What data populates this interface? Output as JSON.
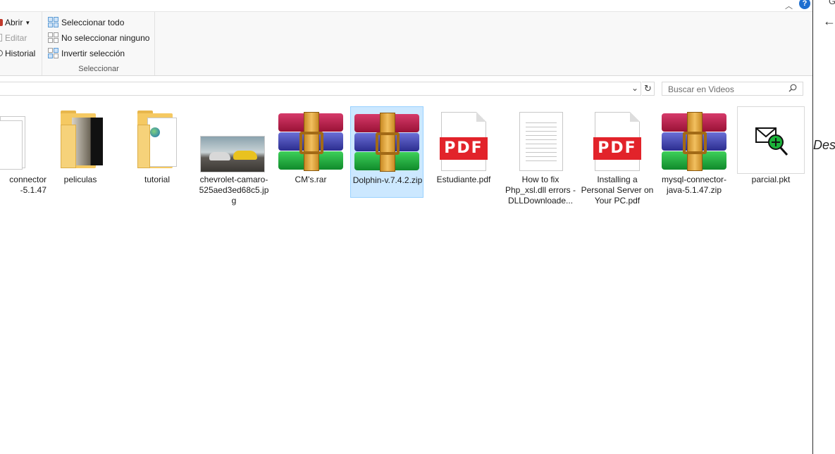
{
  "ribbon": {
    "open_label": "Abrir",
    "edit_label": "Editar",
    "history_label": "Historial",
    "select_all_label": "Seleccionar todo",
    "select_none_label": "No seleccionar ninguno",
    "invert_label": "Invertir selección",
    "group_label": "Seleccionar"
  },
  "search": {
    "placeholder": "Buscar en Videos"
  },
  "files": [
    {
      "name": "connector\n-5.1.47",
      "type": "folder-partial"
    },
    {
      "name": "peliculas",
      "type": "folder"
    },
    {
      "name": "tutorial",
      "type": "folder"
    },
    {
      "name": "chevrolet-camaro-525aed3ed68c5.jpg",
      "type": "image"
    },
    {
      "name": "CM's.rar",
      "type": "rar"
    },
    {
      "name": "Dolphin-v.7.4.2.zip",
      "type": "rar",
      "selected": true
    },
    {
      "name": "Estudiante.pdf",
      "type": "pdf"
    },
    {
      "name": "How to fix Php_xsl.dll errors - DLLDownloade...",
      "type": "text"
    },
    {
      "name": "Installing a Personal Server on Your PC.pdf",
      "type": "pdf"
    },
    {
      "name": "mysql-connector-java-5.1.47.zip",
      "type": "rar"
    },
    {
      "name": "parcial.pkt",
      "type": "pkt"
    }
  ],
  "right_pane": {
    "cut_text": "Des"
  },
  "colors": {
    "selection": "#cce8ff",
    "pdf_red": "#e2232a",
    "accent": "#1e6fd0"
  }
}
